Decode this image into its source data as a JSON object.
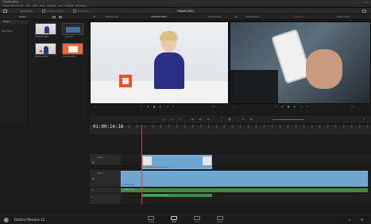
{
  "window": {
    "title": "Projekt (001)"
  },
  "menubar": {
    "items": [
      "DaVinci Resolve",
      "File",
      "Edit",
      "View",
      "Mark",
      "Playback",
      "Color",
      "Fairlight",
      "Workspace"
    ]
  },
  "toolbar": {
    "media_pool": "Media Pool",
    "effects_library": "Effects Library",
    "edit_index": "Edit Index",
    "project_title": "Projekt (001)"
  },
  "subbar": {
    "master": "Master",
    "fit_left": "Fit",
    "src_tc": "00:00:31:16",
    "clip_name": "P1040337.MOV",
    "src_dur": "00:00:23:16",
    "timeline_name": "Timeline 1",
    "rec_tc": "00:01:43:18"
  },
  "left_panel": {
    "header": "Master",
    "item": "Smart Bins"
  },
  "media_pool": {
    "clips": [
      {
        "name": "P1040337.MOV"
      },
      {
        "name": "Timeline 1"
      },
      {
        "name": "P1040338.MOV"
      },
      {
        "name": "P1040341.MOV"
      }
    ]
  },
  "timeline": {
    "timecode": "01:00:14:18",
    "tracks": {
      "v2": {
        "label": "Video 2"
      },
      "v1": {
        "label": "Video 1"
      },
      "a1": {
        "label": "A1"
      },
      "a2": {
        "label": "A2"
      }
    },
    "clips": {
      "v2_title": "Ihr Tutorial zu DaVinci & Resolve",
      "v1_main": "P1040337.MOV",
      "a1_main": "P1040337.MOV",
      "a2_title": "Ihr Tutorial zu DaVinci & Resolve"
    }
  },
  "bottombar": {
    "app_name": "DaVinci Resolve 12",
    "pages": [
      "Media",
      "Edit",
      "Color",
      "Deliver"
    ],
    "active_page": "Edit"
  },
  "colors": {
    "accent_red": "#d0473c",
    "clip_video": "#6ea6cf",
    "clip_audio": "#3c8a46",
    "playhead": "#e03a2e"
  }
}
